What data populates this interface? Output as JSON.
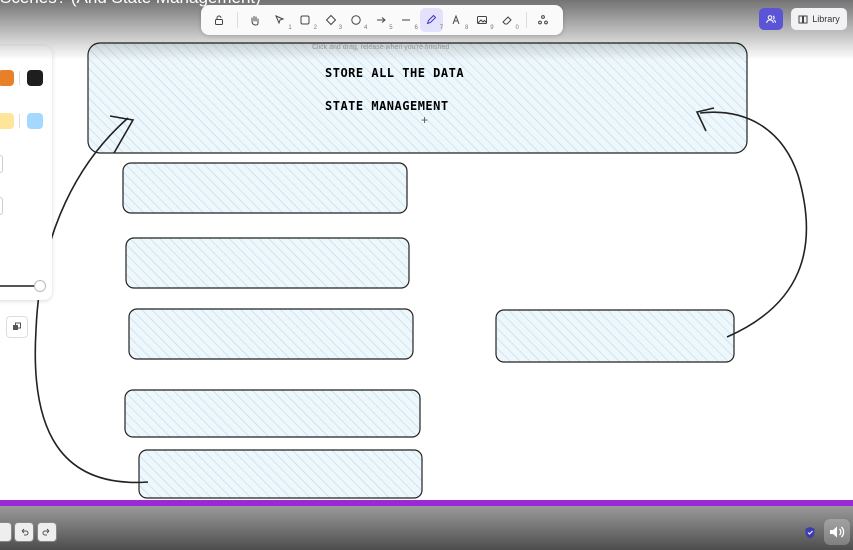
{
  "video": {
    "title": "Scenes? (And State Management)"
  },
  "toolbar": {
    "tools": [
      {
        "name": "lock",
        "num": ""
      },
      {
        "name": "hand",
        "num": ""
      },
      {
        "name": "selection",
        "num": "1"
      },
      {
        "name": "rectangle",
        "num": "2"
      },
      {
        "name": "diamond",
        "num": "3"
      },
      {
        "name": "ellipse",
        "num": "4"
      },
      {
        "name": "arrow",
        "num": "5"
      },
      {
        "name": "line",
        "num": "6"
      },
      {
        "name": "draw",
        "num": "7",
        "active": true
      },
      {
        "name": "text",
        "num": "8"
      },
      {
        "name": "image",
        "num": "9"
      },
      {
        "name": "eraser",
        "num": "0"
      },
      {
        "name": "more-tools",
        "num": ""
      }
    ]
  },
  "header": {
    "library_label": "Library"
  },
  "canvas": {
    "hint": "Click and drag, release when you're finished",
    "title_line1": "STORE ALL THE DATA",
    "title_line2": "STATE MANAGEMENT",
    "cursor": "+"
  },
  "panel": {
    "colors": [
      "#e8802a",
      "#1e1e1e",
      "#ffe59a",
      "#a5d8ff"
    ]
  },
  "colors": {
    "accent": "#5b55d6",
    "box_fill": "#e4f2f7",
    "progress": "#9b2ad6"
  },
  "player": {
    "controls": [
      "undo",
      "redo"
    ]
  }
}
